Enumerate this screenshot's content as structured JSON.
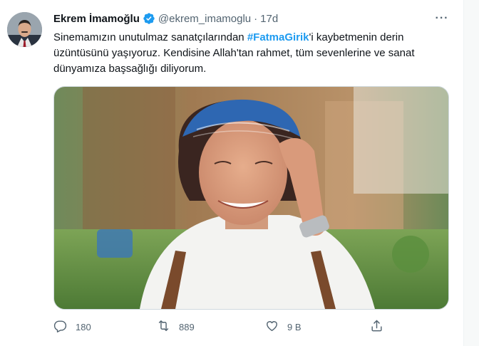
{
  "tweet": {
    "author_name": "Ekrem İmamoğlu",
    "handle": "@ekrem_imamoglu",
    "separator": "·",
    "time": "17d",
    "more_label": "···",
    "text_before": "Sinemamızın unutulmaz sanatçılarından ",
    "hashtag": "#FatmaGirik",
    "text_after": "'i kaybetmenin derin üzüntüsünü yaşıyoruz. Kendisine Allah'tan rahmet, tüm sevenlerine ve sanat dünyamıza başsağlığı diliyorum."
  },
  "actions": {
    "reply_count": "180",
    "retweet_count": "889",
    "like_count": "9 B"
  },
  "colors": {
    "accent": "#1d9bf0",
    "secondary_text": "#536471"
  },
  "icons": {
    "verified": "verified-badge-icon",
    "reply": "reply-icon",
    "retweet": "retweet-icon",
    "like": "heart-icon",
    "share": "share-icon",
    "more": "more-dots-icon"
  }
}
